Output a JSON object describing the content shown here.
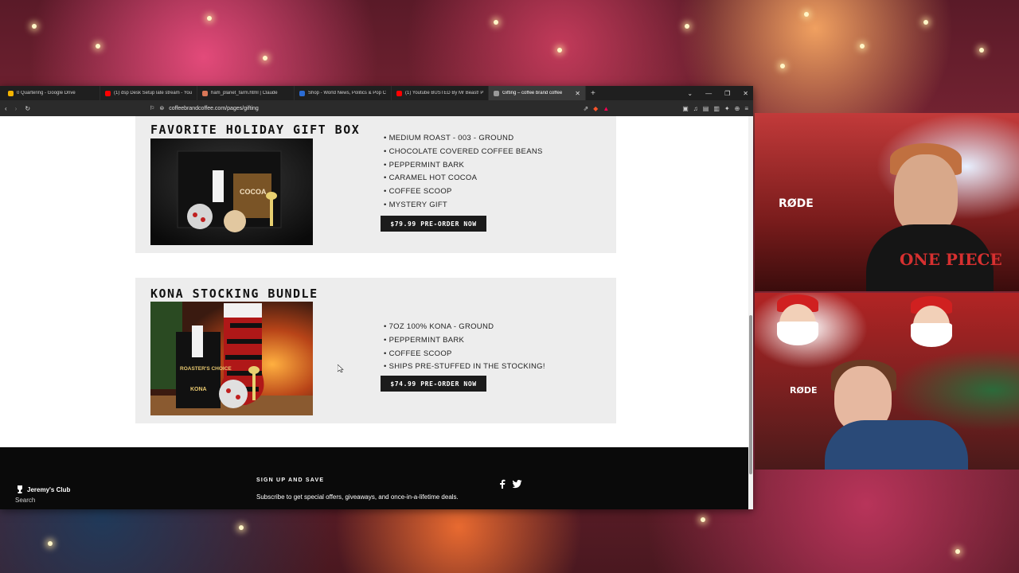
{
  "browser": {
    "tabs": [
      {
        "label": "0 Quartering - Google Drive",
        "color": "#f4b400"
      },
      {
        "label": "(1) dsp Desk Setup late stream - You",
        "color": "#ff0000"
      },
      {
        "label": "ham_planet_farm.html | Claude",
        "color": "#d97757"
      },
      {
        "label": "Shop - World News, Politics & Pop C",
        "color": "#2b6cd4"
      },
      {
        "label": "(1) Youtube BUSTED By Mr Beast! Pr",
        "color": "#ff0000"
      },
      {
        "label": "Gifting – coffee brand coffee",
        "color": "#9a9a9a"
      }
    ],
    "active_tab_index": 5,
    "url": "coffeebrandcoffee.com/pages/gifting"
  },
  "products": [
    {
      "title": "FAVORITE HOLIDAY GIFT BOX",
      "features": [
        "MEDIUM ROAST - 003 - GROUND",
        "CHOCOLATE COVERED COFFEE BEANS",
        "PEPPERMINT BARK",
        "CARAMEL HOT COCOA",
        "COFFEE SCOOP",
        "MYSTERY GIFT"
      ],
      "button_label": "$79.99 PRE-ORDER NOW",
      "image_text": "COCOA"
    },
    {
      "title": "KONA STOCKING BUNDLE",
      "features": [
        "7OZ 100% KONA - GROUND",
        "PEPPERMINT BARK",
        "COFFEE SCOOP",
        "SHIPS PRE-STUFFED IN THE STOCKING!"
      ],
      "button_label": "$74.99 PRE-ORDER NOW",
      "image_text": "ROASTER'S CHOICE",
      "image_text2": "KONA"
    }
  ],
  "footer": {
    "heading": "SIGN UP AND SAVE",
    "text": "Subscribe to get special offers, giveaways, and once-in-a-lifetime deals.",
    "search_label": "Search"
  },
  "overlay": {
    "club_label": "Jeremy's Club",
    "cam1_sweater": "ONE PIECE",
    "mic_label": "RØDE"
  }
}
